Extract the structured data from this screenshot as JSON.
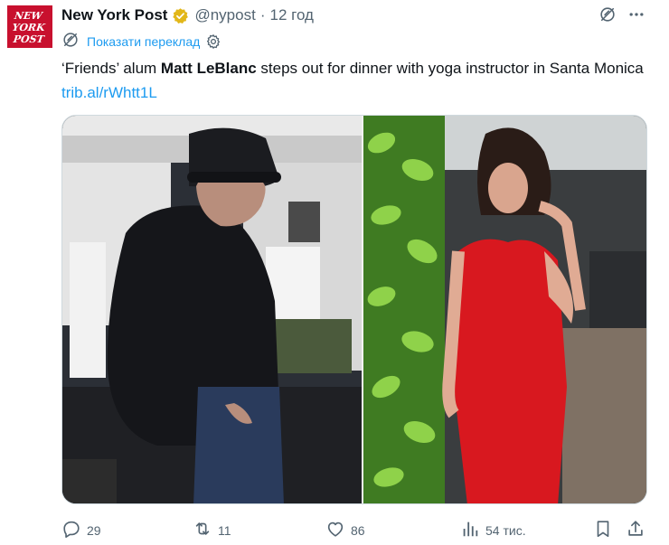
{
  "avatar": {
    "lines": [
      "NEW",
      "YORK",
      "POST"
    ],
    "bg": "#c8102e"
  },
  "author": {
    "name": "New York Post",
    "handle": "@nypost",
    "time": "12 год"
  },
  "translate": {
    "label": "Показати переклад"
  },
  "tweet": {
    "quote_open": "‘Friends’ alum ",
    "bold_name": "Matt LeBlanc",
    "rest": " steps out for dinner with yoga instructor in Santa Monica ",
    "link": "trib.al/rWhtt1L"
  },
  "media": {
    "icons": [
      "photo-left",
      "photo-right"
    ]
  },
  "actions": {
    "replies": "29",
    "reposts": "11",
    "likes": "86",
    "views": "54 тис."
  },
  "colors": {
    "accent": "#1d9bf0",
    "secondary_text": "#536471",
    "verified": "#e2b719"
  }
}
